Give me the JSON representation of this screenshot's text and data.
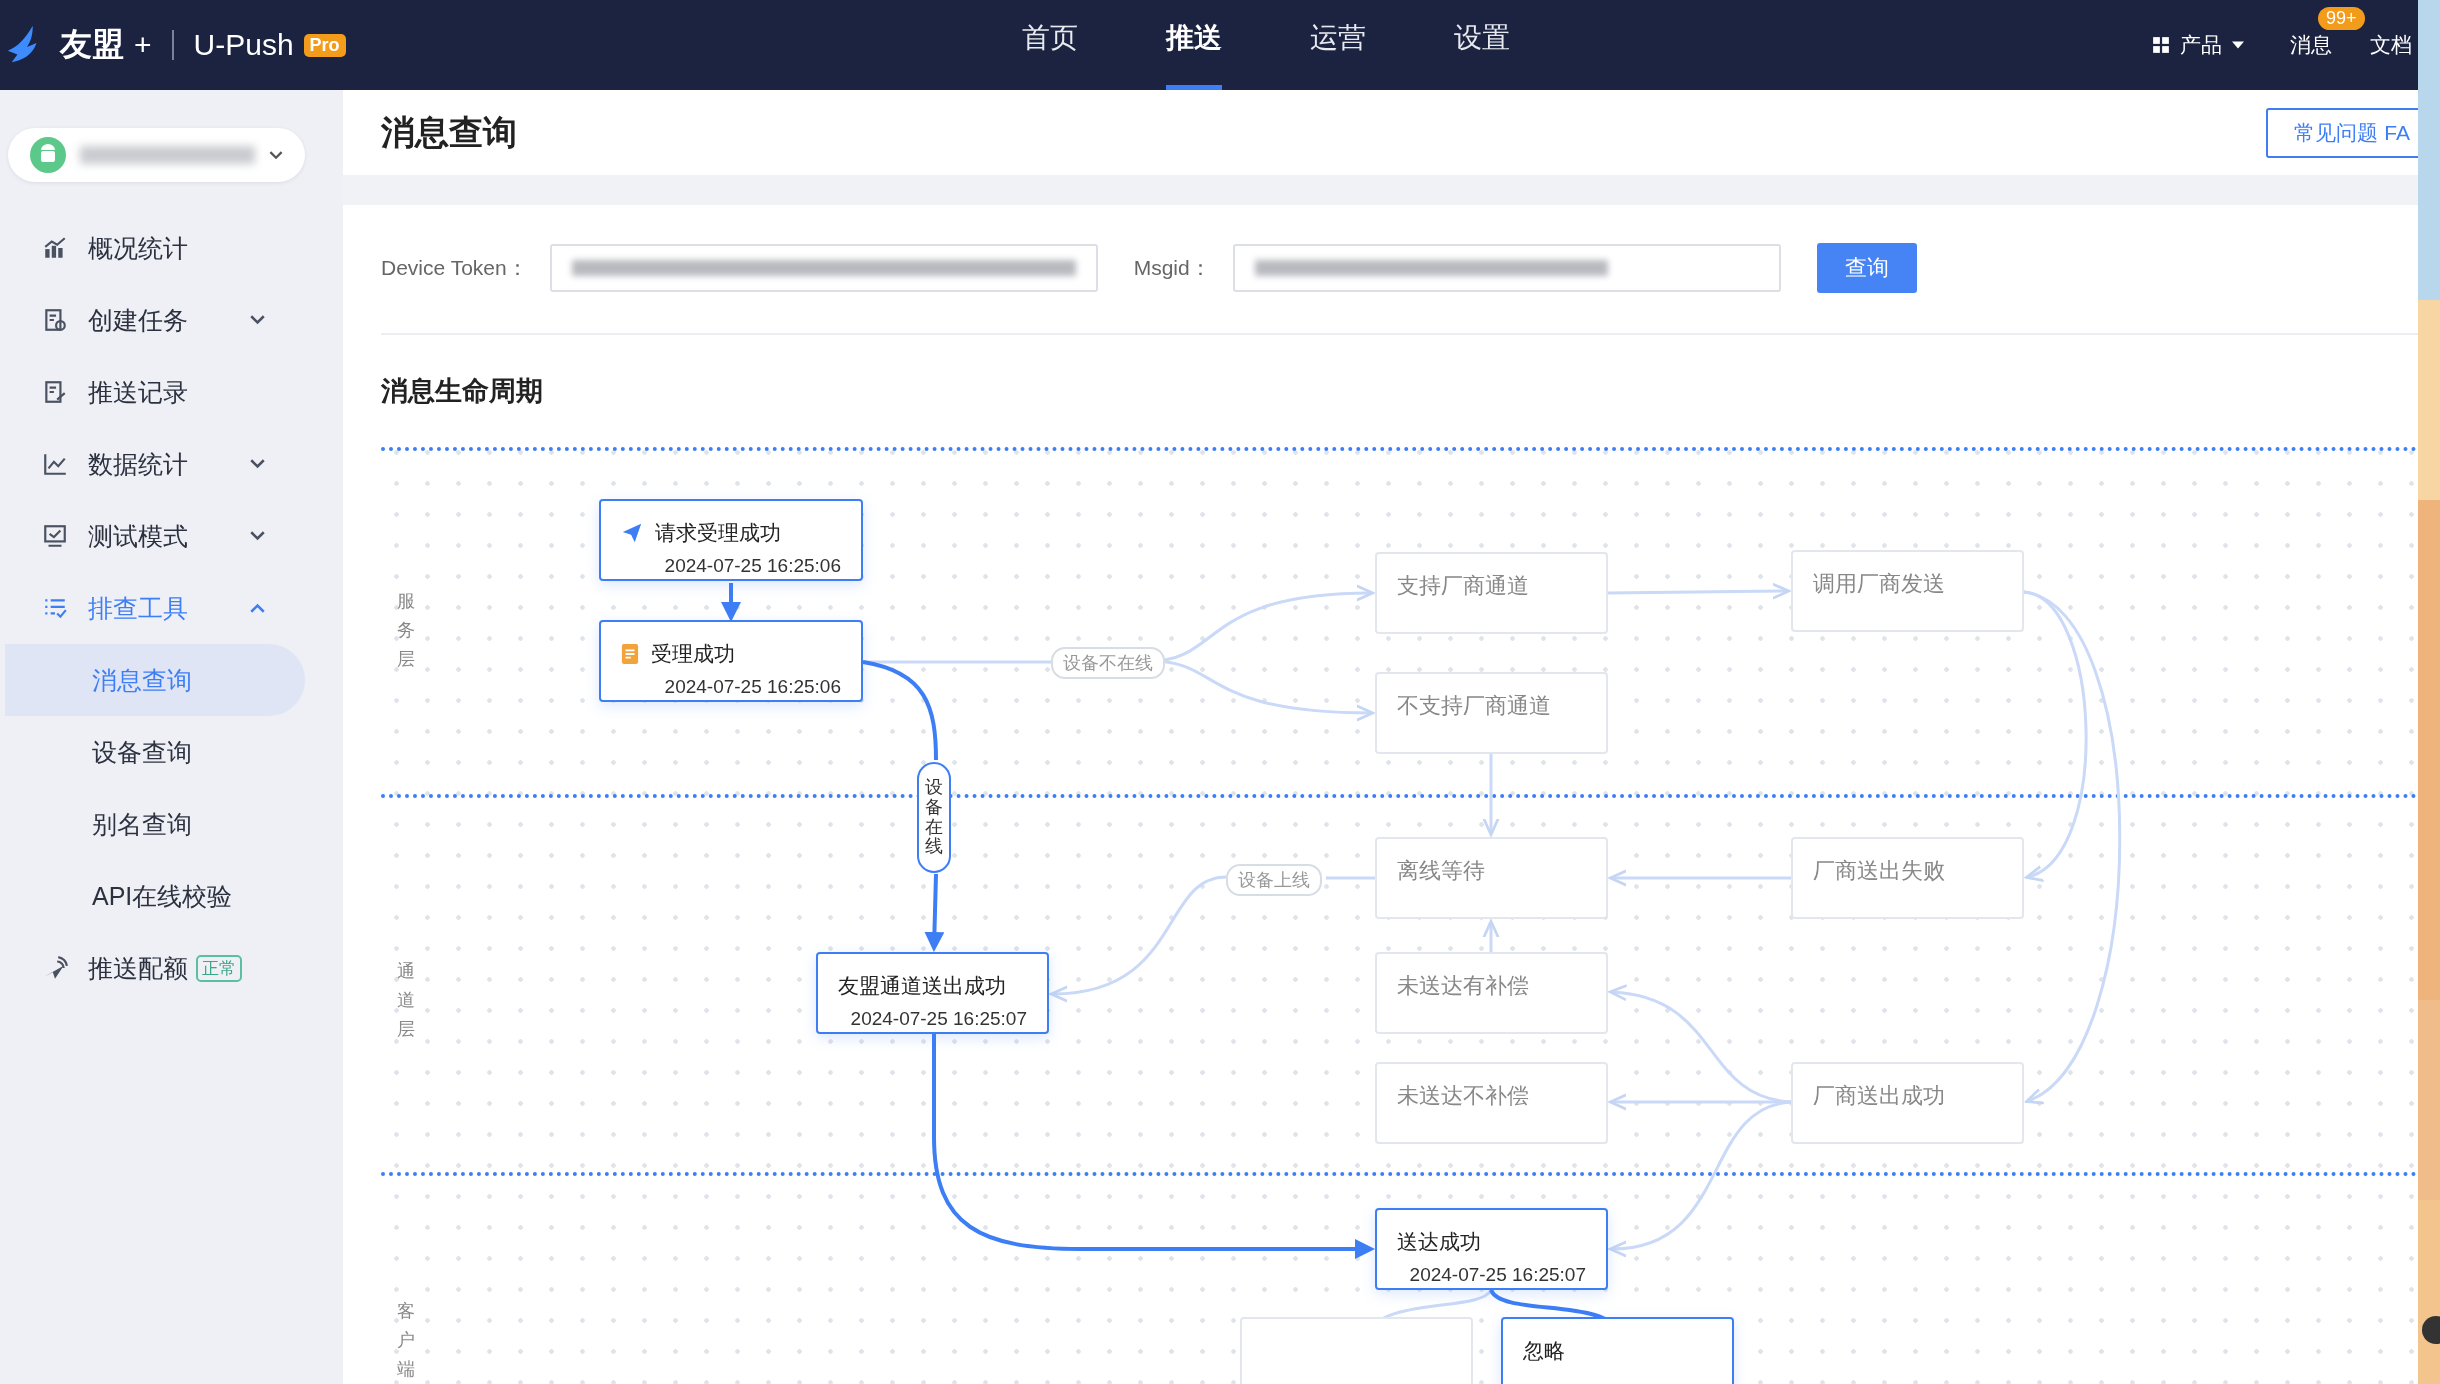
{
  "top_bar": {
    "brand": "友盟",
    "brand_plus": "+",
    "product": "U-Push",
    "badge": "Pro",
    "nav": [
      {
        "label": "首页",
        "selected": false
      },
      {
        "label": "推送",
        "selected": true
      },
      {
        "label": "运营",
        "selected": false
      },
      {
        "label": "设置",
        "selected": false
      }
    ],
    "products_menu": "产品",
    "messages": "消息",
    "messages_badge": "99+",
    "docs": "文档"
  },
  "sidebar": {
    "items": [
      {
        "label": "概况统计"
      },
      {
        "label": "创建任务",
        "expanded": false
      },
      {
        "label": "推送记录"
      },
      {
        "label": "数据统计",
        "expanded": false
      },
      {
        "label": "测试模式",
        "expanded": false
      },
      {
        "label": "排查工具",
        "expanded": true,
        "children": [
          {
            "label": "消息查询",
            "selected": true
          },
          {
            "label": "设备查询",
            "selected": false
          },
          {
            "label": "别名查询",
            "selected": false
          },
          {
            "label": "API在线校验",
            "selected": false
          }
        ]
      },
      {
        "label": "推送配额",
        "tag": "正常"
      }
    ]
  },
  "page": {
    "title": "消息查询",
    "help_button": "常见问题 FA"
  },
  "query_form": {
    "device_token_label": "Device Token：",
    "msgid_label": "Msgid：",
    "submit": "查询"
  },
  "lifecycle": {
    "title": "消息生命周期",
    "lanes": [
      "服务层",
      "通道层",
      "客户端"
    ],
    "nodes": [
      {
        "kind": "sent",
        "title": "请求受理成功",
        "time": "2024-07-25 16:25:06",
        "active": true
      },
      {
        "kind": "accepted",
        "title": "受理成功",
        "time": "2024-07-25 16:25:06",
        "active": true
      },
      {
        "kind": "step",
        "title": "支持厂商通道",
        "active": false
      },
      {
        "kind": "step",
        "title": "不支持厂商通道",
        "active": false
      },
      {
        "kind": "step",
        "title": "调用厂商发送",
        "active": false
      },
      {
        "kind": "step",
        "title": "离线等待",
        "active": false
      },
      {
        "kind": "step",
        "title": "厂商送出失败",
        "active": false
      },
      {
        "kind": "step",
        "title": "友盟通道送出成功",
        "time": "2024-07-25 16:25:07",
        "active": true
      },
      {
        "kind": "step",
        "title": "未送达有补偿",
        "active": false
      },
      {
        "kind": "step",
        "title": "未送达不补偿",
        "active": false
      },
      {
        "kind": "step",
        "title": "厂商送出成功",
        "active": false
      },
      {
        "kind": "step",
        "title": "送达成功",
        "time": "2024-07-25 16:25:07",
        "active": true
      },
      {
        "active": false
      },
      {
        "kind": "step",
        "title": "忽略",
        "active": true
      }
    ],
    "edge_labels": [
      "设备不在线",
      "设备在线",
      "设备上线"
    ]
  }
}
